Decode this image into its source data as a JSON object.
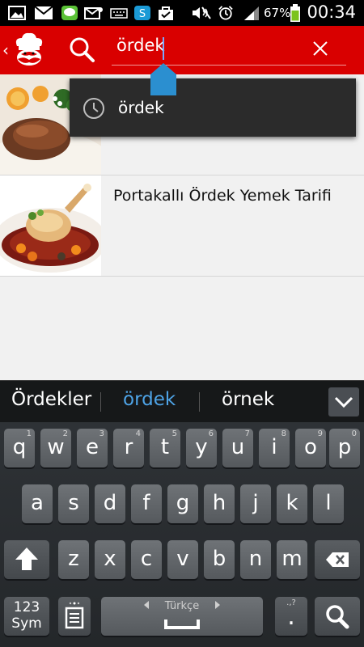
{
  "status_bar": {
    "battery_percent": "67%",
    "time": "00:34",
    "icons": [
      "image-icon",
      "gmail-icon",
      "line-icon",
      "email-icon",
      "keyboard-icon",
      "skype-icon",
      "shopping-bag-icon",
      "mute-icon",
      "alarm-icon",
      "signal-icon",
      "battery-icon"
    ]
  },
  "action_bar": {
    "query": "ördek",
    "color": "#d90000"
  },
  "suggestion": {
    "text": "ördek"
  },
  "results": [
    {
      "title": ""
    },
    {
      "title": "Portakallı Ördek Yemek Tarifi"
    }
  ],
  "keyboard": {
    "predictions": [
      "Ördekler",
      "ördek",
      "örnek"
    ],
    "selected_prediction": 1,
    "row1": [
      {
        "k": "q",
        "s": "1"
      },
      {
        "k": "w",
        "s": "2"
      },
      {
        "k": "e",
        "s": "3"
      },
      {
        "k": "r",
        "s": "4"
      },
      {
        "k": "t",
        "s": "5"
      },
      {
        "k": "y",
        "s": "6"
      },
      {
        "k": "u",
        "s": "7"
      },
      {
        "k": "i",
        "s": "8"
      },
      {
        "k": "o",
        "s": "9"
      },
      {
        "k": "p",
        "s": "0"
      }
    ],
    "row2": [
      "a",
      "s",
      "d",
      "f",
      "g",
      "h",
      "j",
      "k",
      "l"
    ],
    "row3": [
      "z",
      "x",
      "c",
      "v",
      "b",
      "n",
      "m"
    ],
    "sym_label_1": "123",
    "sym_label_2": "Sym",
    "language": "Türkçe",
    "period": "."
  }
}
